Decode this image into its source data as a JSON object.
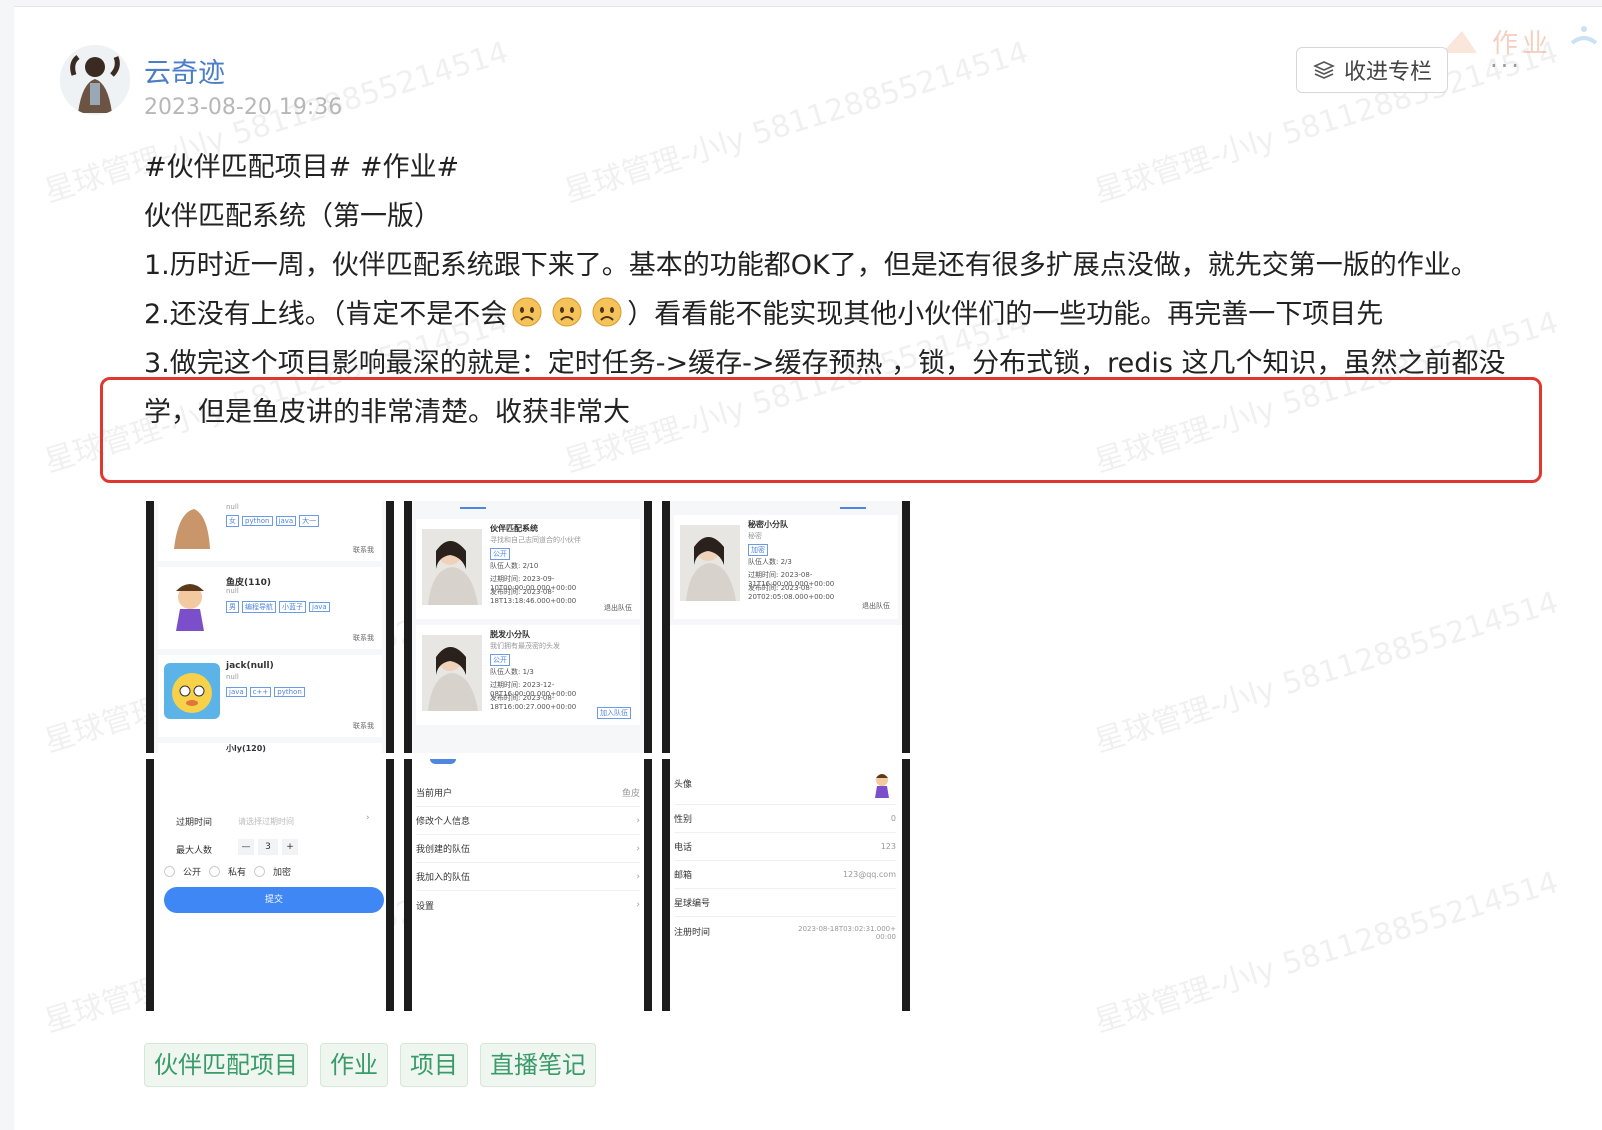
{
  "watermark": "星球管理-小ly 581128855214514",
  "ribbon_text": "作业",
  "author": {
    "name": "云奇迹",
    "date": "2023-08-20 19:36"
  },
  "actions": {
    "collect_label": "收进专栏",
    "collect_icon": "layers-icon",
    "more_label": "···"
  },
  "post": {
    "lines": [
      "#伙伴匹配项目# #作业#",
      "伙伴匹配系统（第一版）",
      "1.历时近一周，伙伴匹配系统跟下来了。基本的功能都OK了，但是还有很多扩展点没做，就先交第一版的作业。",
      "2.还没有上线。（肯定不是不会",
      "）看看能不能实现其他小伙伴们的一些功能。再完善一下项目先",
      "3.做完这个项目影响最深的就是：定时任务->缓存->缓存预热 ，锁，分布式锁，redis 这几个知识，虽然之前都没学，但是鱼皮讲的非常清楚。收获非常大"
    ],
    "emoji_count": 3,
    "highlight_color": "#e0382e"
  },
  "screenshots": {
    "users": [
      {
        "name": "",
        "desc": "null",
        "tags": [
          "女",
          "python",
          "java",
          "大一"
        ],
        "action": "联系我"
      },
      {
        "name": "鱼皮(110)",
        "desc": "null",
        "tags": [
          "男",
          "编程导航",
          "小蓝子",
          "java"
        ],
        "action": "联系我"
      },
      {
        "name": "jack(null)",
        "desc": "null",
        "tags": [
          "java",
          "c++",
          "python"
        ],
        "action": "联系我"
      },
      {
        "name": "小ly(120)"
      }
    ],
    "teams": [
      {
        "name": "伙伴匹配系统",
        "desc": "寻找和自己志同道合的小伙伴",
        "status": "公开",
        "count": "队伍人数: 2/10",
        "expire": "过期时间: 2023-09-10T00:00:00.000+00:00",
        "created": "发布时间: 2023-08-18T13:18:46.000+00:00",
        "action": "退出队伍"
      },
      {
        "name": "脱发小分队",
        "desc": "我们拥有最茂密的头发",
        "status": "公开",
        "count": "队伍人数: 1/3",
        "expire": "过期时间: 2023-12-08T16:00:00.000+00:00",
        "created": "发布时间: 2023-08-18T16:00:27.000+00:00",
        "action": "加入队伍"
      }
    ],
    "secret_team": {
      "name": "秘密小分队",
      "desc": "秘密",
      "status": "加密",
      "count": "队伍人数: 2/3",
      "expire": "过期时间: 2023-08-31T16:00:00.000+00:00",
      "created": "发布时间: 2023-08-20T02:05:08.000+00:00",
      "action": "退出队伍"
    },
    "create_form": {
      "expire_label": "过期时间",
      "expire_placeholder": "请选择过期时间",
      "max_label": "最大人数",
      "max_value": "3",
      "minus": "—",
      "plus": "+",
      "radio_options": [
        "公开",
        "私有",
        "加密"
      ],
      "submit": "提交"
    },
    "user_center": {
      "rows": [
        {
          "label": "当前用户",
          "value": "鱼皮"
        },
        {
          "label": "修改个人信息",
          "value": ""
        },
        {
          "label": "我创建的队伍",
          "value": ""
        },
        {
          "label": "我加入的队伍",
          "value": ""
        },
        {
          "label": "设置",
          "value": ""
        }
      ]
    },
    "user_edit": {
      "rows": [
        {
          "label": "头像",
          "value": ""
        },
        {
          "label": "性别",
          "value": "0"
        },
        {
          "label": "电话",
          "value": "123"
        },
        {
          "label": "邮箱",
          "value": "123@qq.com"
        },
        {
          "label": "星球编号",
          "value": ""
        },
        {
          "label": "注册时间",
          "value": "2023-08-18T03:02:31.000+00:00"
        }
      ]
    }
  },
  "tags": [
    "伙伴匹配项目",
    "作业",
    "项目",
    "直播笔记"
  ]
}
